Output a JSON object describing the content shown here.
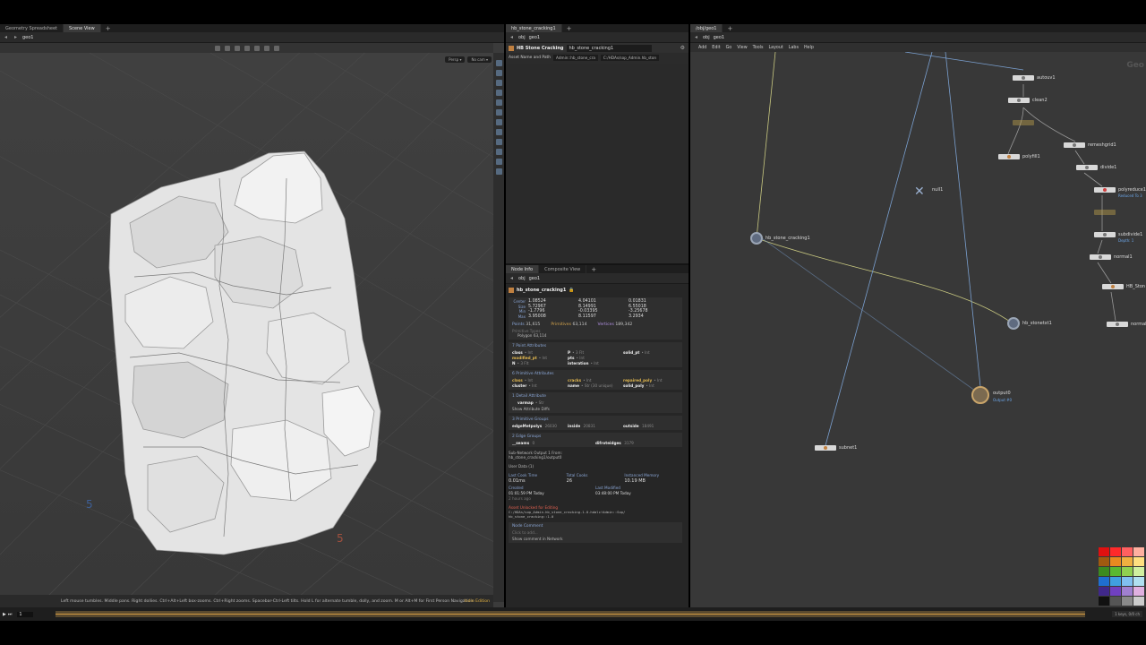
{
  "viewport": {
    "tabs": [
      "Geometry Spreadsheet",
      "Scene View"
    ],
    "path": "geo1",
    "camera_buttons": [
      "Persp ▾",
      "No cam ▾"
    ],
    "status": "Left mouse tumbles. Middle pans. Right dollies. Ctrl+Alt+Left box-zooms. Ctrl+Right zooms. Spacebar-Ctrl-Left tilts. Hold L for alternate tumble, dolly, and zoom. M or Alt+M for First Person Navigation.",
    "status_right": "Indie Edition",
    "grid_labels": [
      "5",
      "5"
    ]
  },
  "params": {
    "tab": "hb_stone_cracking1",
    "path": [
      "obj",
      "geo1"
    ],
    "title": "HB Stone Cracking",
    "node_name": "hb_stone_cracking1",
    "asset_label": "Asset Name and Path",
    "asset_name": "Admin::hb_stone_cra",
    "asset_path": "C:/HDAs/sop_Admin.hb_ston"
  },
  "info": {
    "tabs": [
      "Node Info",
      "Composite View"
    ],
    "path": [
      "obj",
      "geo1"
    ],
    "node": "hb_stone_cracking1",
    "bbox": {
      "labels": [
        "Center",
        "Size",
        "Min",
        "Max"
      ],
      "rows": [
        [
          "1.08524",
          "4.04101",
          "0.01831"
        ],
        [
          "5.72967",
          "8.14991",
          "6.55018"
        ],
        [
          "-1.7796",
          "-0.03395",
          "-3.25678"
        ],
        [
          "3.95008",
          "8.11597",
          "3.2934"
        ]
      ]
    },
    "points_label": "Points",
    "points": "31,615",
    "prims_label": "Primitives",
    "prims": "63,114",
    "verts_label": "Vertices",
    "verts": "189,342",
    "prim_type_label": "Primitive Types",
    "prim_type": "Polygon",
    "prim_type_count": "63,114",
    "point_attrs_head": "7 Point Attributes",
    "point_attrs": [
      {
        "name": "class",
        "type": "• Int"
      },
      {
        "name": "P",
        "type": "• 3 Flt"
      },
      {
        "name": "solid_pt",
        "type": "• Int"
      },
      {
        "name": "modified_pt",
        "type": "• Int"
      },
      {
        "name": "pts",
        "type": "• Int"
      },
      {
        "name": "",
        "type": ""
      },
      {
        "name": "N",
        "type": "• 3 Flt"
      },
      {
        "name": "interation",
        "type": "• Int"
      },
      {
        "name": "",
        "type": ""
      }
    ],
    "prim_attrs_head": "6 Primitive Attributes",
    "prim_attrs": [
      {
        "name": "class",
        "type": "• Int"
      },
      {
        "name": "cracks",
        "type": "• Int"
      },
      {
        "name": "repaired_poly",
        "type": "• Int"
      },
      {
        "name": "cluster",
        "type": "• Int"
      },
      {
        "name": "name",
        "type": "• Str (30 unique)"
      },
      {
        "name": "solid_poly",
        "type": "• Int"
      }
    ],
    "detail_attrs_head": "1 Detail Attribute",
    "detail_attr": "varmap",
    "detail_attr_type": "• Str",
    "show_diffs": "Show Attribute Diffs",
    "prim_groups_head": "3 Primitive Groups",
    "prim_groups": [
      {
        "name": "edgeMetpolys",
        "count": "26030"
      },
      {
        "name": "inside",
        "count": "20831"
      },
      {
        "name": "outside",
        "count": "18491"
      }
    ],
    "edge_groups_head": "2 Edge Groups",
    "edge_groups": [
      {
        "name": "__seams",
        "count": "0"
      },
      {
        "name": "difroteidges",
        "count": "3179"
      }
    ],
    "subnet_out": "Sub-Network Output 1 From:",
    "subnet_out_path": "hb_stone_cracking1/output0",
    "user_data": "User Data (1)",
    "cook_time_label": "Last Cook Time",
    "cook_time": "0.01ms",
    "total_cooks_label": "Total Cooks",
    "total_cooks": "26",
    "memory_label": "Instanced Memory",
    "memory": "10.19 MB",
    "created_label": "Created",
    "created": "01:01:59 PM Today",
    "created_ago": "2 hours ago",
    "modified_label": "Last Modified",
    "modified": "03:48:00 PM Today",
    "asset_warn": "Asset Unlocked for Editing",
    "asset_def": "C:/HDAs/sop_Admin.hb_stone_cracking.1.0.hdalc!Admin::Sop/",
    "asset_def2": "hb_stone_cracking::1.0",
    "comment_label": "Node Comment",
    "comment_placeholder": "Click to add...",
    "show_comment": "Show comment in Network"
  },
  "network": {
    "tab": "/obj/geo1",
    "path": [
      "obj",
      "geo1"
    ],
    "menu": [
      "Add",
      "Edit",
      "Go",
      "View",
      "Tools",
      "Layout",
      "Labs",
      "Help"
    ],
    "context_label": "Geo",
    "nodes": {
      "autouv1": "autouv1",
      "clean2": "clean2",
      "remeshgrid1": "remeshgrid1",
      "polyfill1": "polyfill1",
      "divide1": "divide1",
      "null1": "null1",
      "polyreduce1": "polyreduce1",
      "polyreduce1_sub": "Reduced To 3",
      "hb_stone_cracking1": "hb_stone_cracking1",
      "subdivide1": "subdivide1",
      "subdivide1_sub": "Depth: 1",
      "normal1": "normal1",
      "hb_stonetxt": "HB_Ston",
      "hb_stonetxt1": "hb_stonetxt1",
      "normal2": "normal",
      "output0": "output0",
      "output0_sub": "Output #0",
      "subnet1": "subnet1"
    },
    "swatch_colors": [
      "#e01010",
      "#ff2a2a",
      "#ff6060",
      "#ffb0a0",
      "#a05a10",
      "#e88a20",
      "#f0b040",
      "#ffe080",
      "#3c8a20",
      "#5ab830",
      "#90d050",
      "#d0f0a0",
      "#1f6fd0",
      "#40a0e0",
      "#80c0f0",
      "#b0e0f0",
      "#40288a",
      "#7040c0",
      "#a080d0",
      "#e0b0e0",
      "#111111",
      "#555555",
      "#8a8a8a",
      "#cccccc"
    ]
  },
  "timeline": {
    "frame": "1",
    "right_label": "1 keys, 0/0 ch"
  }
}
